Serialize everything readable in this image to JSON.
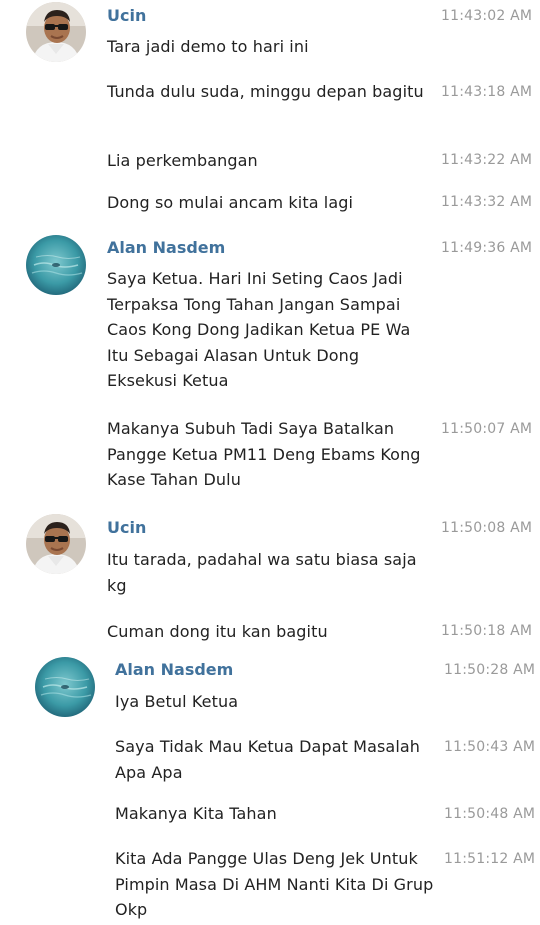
{
  "messages": [
    {
      "sender": "Ucin",
      "avatar_icon": "man-in-sunglasses-avatar",
      "items": [
        {
          "text": "Tara jadi demo to hari ini",
          "time": "11:43:02 AM"
        },
        {
          "text": "Tunda dulu suda, minggu depan bagitu",
          "time": "11:43:18 AM"
        },
        {
          "text": "Lia perkembangan",
          "time": "11:43:22 AM"
        },
        {
          "text": "Dong so mulai ancam kita lagi",
          "time": "11:43:32 AM"
        }
      ]
    },
    {
      "sender": "Alan Nasdem",
      "avatar_icon": "blue-water-avatar",
      "items": [
        {
          "text": "Saya Ketua. Hari Ini Seting Caos Jadi Terpaksa Tong Tahan Jangan Sampai Caos Kong Dong Jadikan Ketua PE Wa Itu Sebagai Alasan Untuk Dong Eksekusi Ketua",
          "time": "11:49:36 AM"
        },
        {
          "text": "Makanya Subuh Tadi Saya Batalkan Pangge Ketua PM11 Deng Ebams Kong Kase Tahan Dulu",
          "time": "11:50:07 AM"
        }
      ]
    },
    {
      "sender": "Ucin",
      "avatar_icon": "man-in-sunglasses-avatar",
      "items": [
        {
          "text": "Itu tarada, padahal wa satu biasa saja kg",
          "time": "11:50:08 AM"
        },
        {
          "text": "Cuman dong itu kan bagitu",
          "time": "11:50:18 AM"
        }
      ]
    },
    {
      "sender": "Alan Nasdem",
      "avatar_icon": "blue-water-avatar",
      "items": [
        {
          "text": "Iya Betul Ketua",
          "time": "11:50:28 AM"
        },
        {
          "text": "Saya Tidak Mau Ketua Dapat Masalah Apa Apa",
          "time": "11:50:43 AM"
        },
        {
          "text": "Makanya Kita Tahan",
          "time": "11:50:48 AM"
        },
        {
          "text": "Kita Ada Pangge Ulas Deng Jek Untuk Pimpin Masa Di AHM Nanti Kita Di Grup Okp",
          "time": "11:51:12 AM"
        }
      ]
    }
  ]
}
